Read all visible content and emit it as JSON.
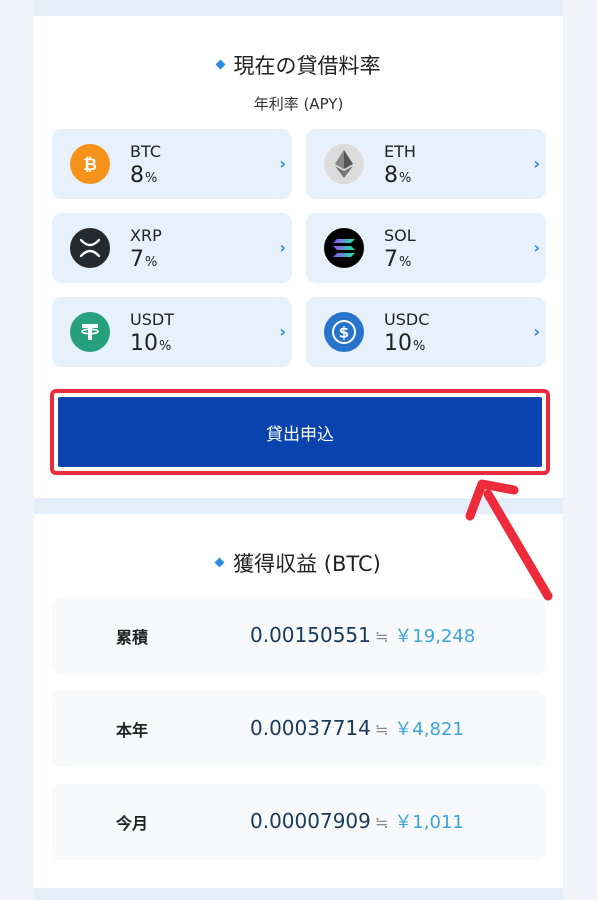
{
  "lending": {
    "title": "現在の貸借料率",
    "subtitle": "年利率 (APY)",
    "percent_unit": "%",
    "coins": [
      {
        "symbol": "BTC",
        "rate": "8",
        "icon": "bitcoin-icon",
        "color": "#f7931a"
      },
      {
        "symbol": "ETH",
        "rate": "8",
        "icon": "ethereum-icon",
        "color": "#d9d9d9"
      },
      {
        "symbol": "XRP",
        "rate": "7",
        "icon": "xrp-icon",
        "color": "#23292f"
      },
      {
        "symbol": "SOL",
        "rate": "7",
        "icon": "solana-icon",
        "color": "#000000"
      },
      {
        "symbol": "USDT",
        "rate": "10",
        "icon": "tether-icon",
        "color": "#26a17b"
      },
      {
        "symbol": "USDC",
        "rate": "10",
        "icon": "usdc-icon",
        "color": "#2775ca"
      }
    ],
    "apply_label": "貸出申込"
  },
  "earnings": {
    "title": "獲得収益 (BTC)",
    "approx_symbol": "≒",
    "rows": [
      {
        "label": "累積",
        "btc": "0.00150551",
        "jpy": "￥19,248"
      },
      {
        "label": "本年",
        "btc": "0.00037714",
        "jpy": "￥4,821"
      },
      {
        "label": "今月",
        "btc": "0.00007909",
        "jpy": "￥1,011"
      }
    ]
  },
  "colors": {
    "accent": "#2a8be0",
    "button": "#0a43ad",
    "highlight": "#ee2b3a"
  }
}
